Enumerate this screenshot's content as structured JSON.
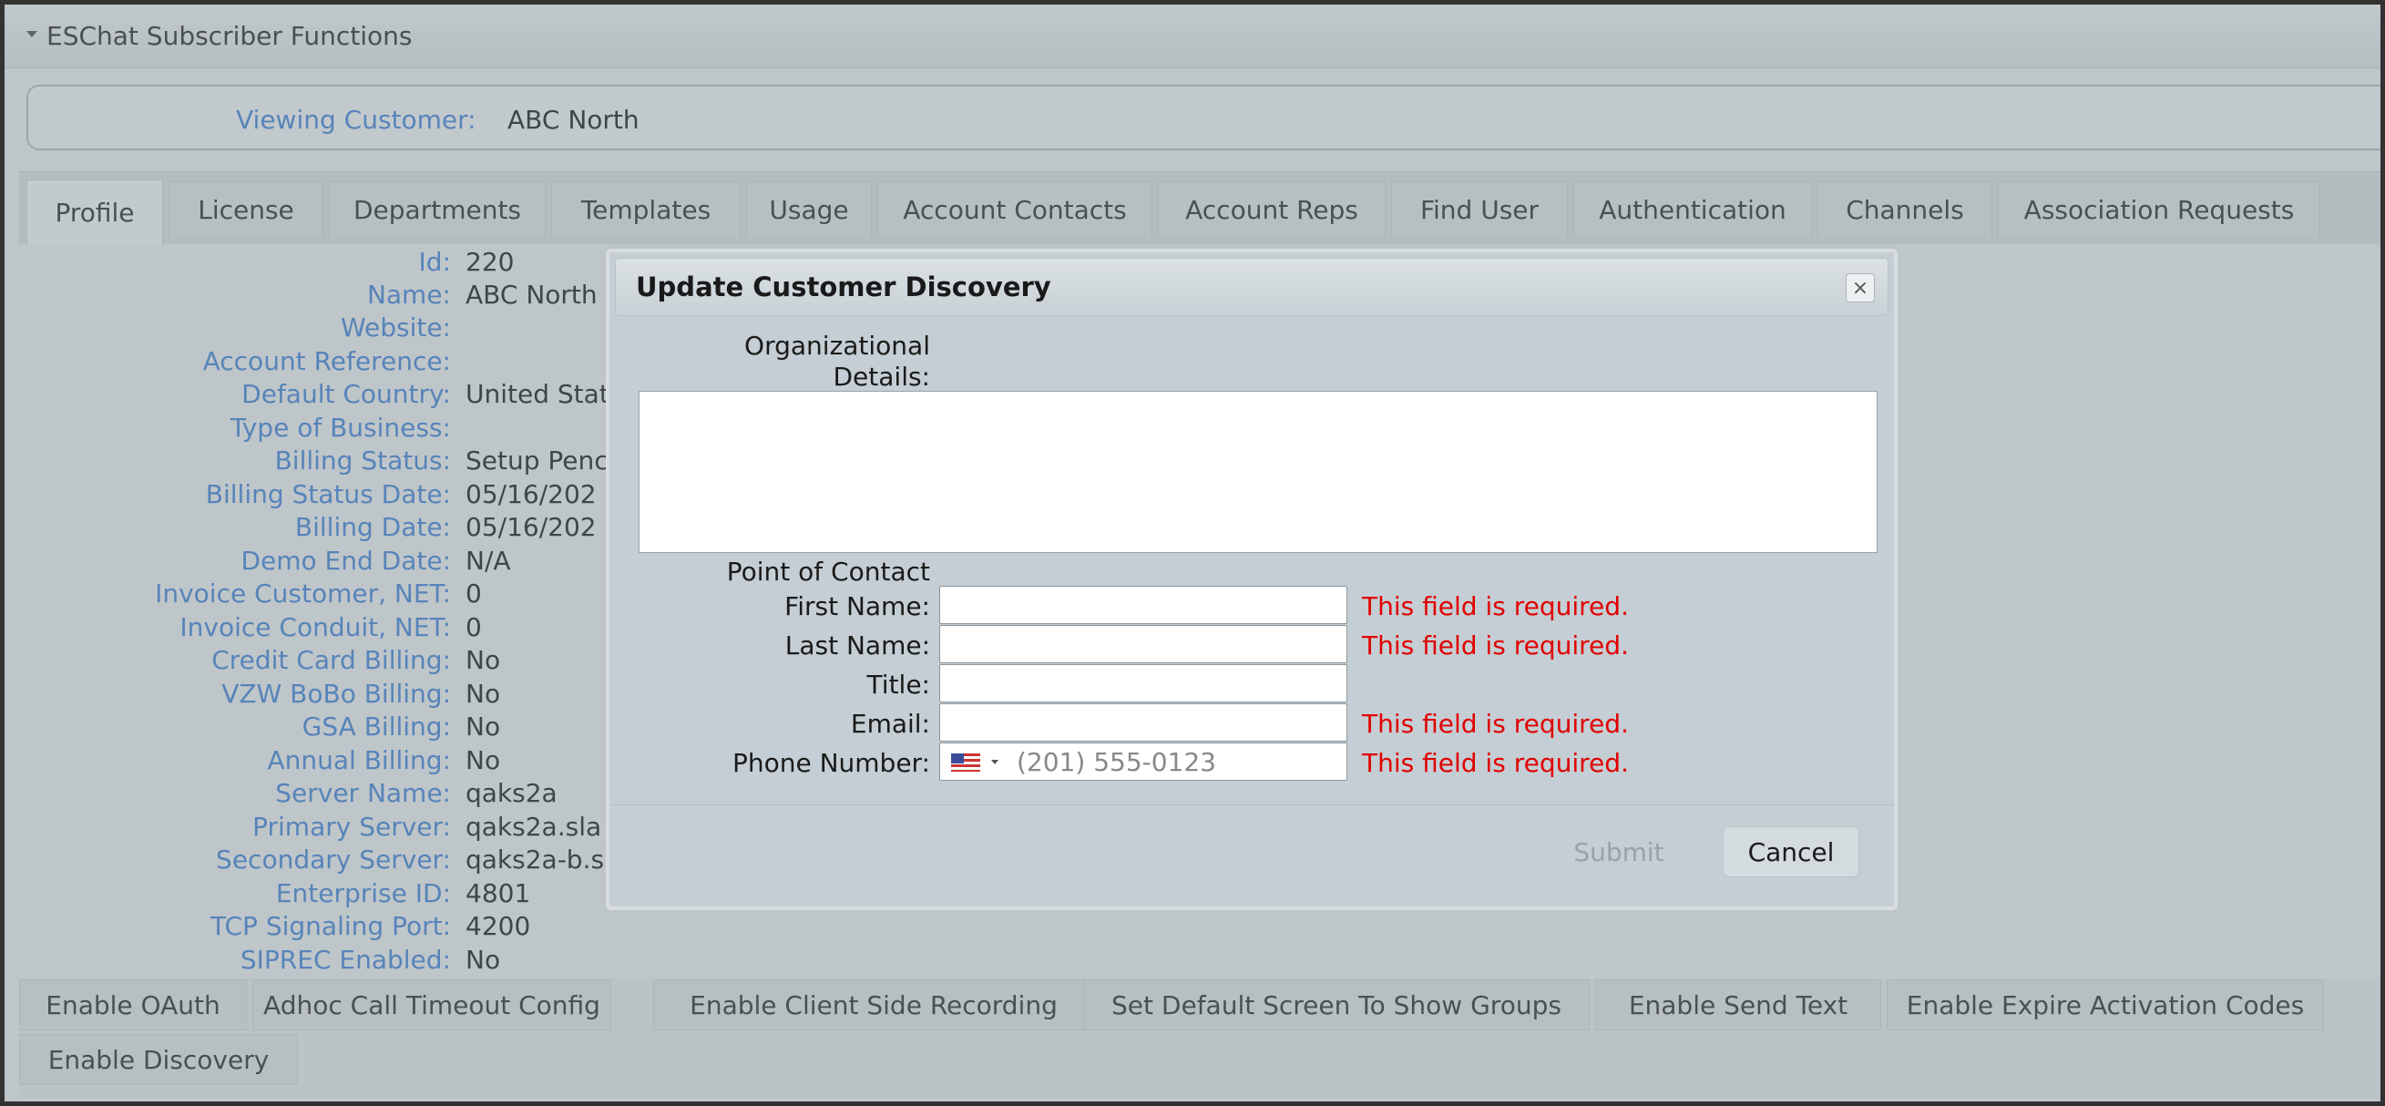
{
  "panel": {
    "title": "ESChat Subscriber Functions"
  },
  "customer": {
    "label": "Viewing Customer:",
    "value": "ABC North"
  },
  "tabs": [
    "Profile",
    "License",
    "Departments",
    "Templates",
    "Usage",
    "Account Contacts",
    "Account Reps",
    "Find User",
    "Authentication",
    "Channels",
    "Association Requests"
  ],
  "profile": [
    {
      "label": "Id:",
      "value": "220"
    },
    {
      "label": "Name:",
      "value": "ABC North"
    },
    {
      "label": "Website:",
      "value": ""
    },
    {
      "label": "Account Reference:",
      "value": ""
    },
    {
      "label": "Default Country:",
      "value": "United Stat"
    },
    {
      "label": "Type of Business:",
      "value": ""
    },
    {
      "label": "Billing Status:",
      "value": "Setup Penc"
    },
    {
      "label": "Billing Status Date:",
      "value": "05/16/202"
    },
    {
      "label": "Billing Date:",
      "value": "05/16/202"
    },
    {
      "label": "Demo End Date:",
      "value": "N/A"
    },
    {
      "label": "Invoice Customer, NET:",
      "value": "0"
    },
    {
      "label": "Invoice Conduit, NET:",
      "value": "0"
    },
    {
      "label": "Credit Card Billing:",
      "value": "No"
    },
    {
      "label": "VZW BoBo Billing:",
      "value": "No"
    },
    {
      "label": "GSA Billing:",
      "value": "No"
    },
    {
      "label": "Annual Billing:",
      "value": "No"
    },
    {
      "label": "Server Name:",
      "value": "qaks2a"
    },
    {
      "label": "Primary Server:",
      "value": "qaks2a.sla"
    },
    {
      "label": "Secondary Server:",
      "value": "qaks2a-b.s"
    },
    {
      "label": "Enterprise ID:",
      "value": "4801"
    },
    {
      "label": "TCP Signaling Port:",
      "value": "4200"
    },
    {
      "label": "SIPREC Enabled:",
      "value": "No"
    }
  ],
  "bottom_buttons": [
    "Enable OAuth",
    "Adhoc Call Timeout Config",
    "Enable Client Side Recording",
    "Set Default Screen To Show Groups",
    "Enable Send Text",
    "Enable Expire Activation Codes",
    "Enable Discovery"
  ],
  "dialog": {
    "title": "Update Customer Discovery",
    "close": "×",
    "org_label_line1": "Organizational",
    "org_label_line2": "Details:",
    "org_value": "",
    "poc_heading": "Point of Contact",
    "fields": [
      {
        "label": "First Name:",
        "value": "",
        "error": "This field is required."
      },
      {
        "label": "Last Name:",
        "value": "",
        "error": "This field is required."
      },
      {
        "label": "Title:",
        "value": "",
        "error": ""
      },
      {
        "label": "Email:",
        "value": "",
        "error": "This field is required."
      },
      {
        "label": "Phone Number:",
        "value": "",
        "placeholder": "(201) 555-0123",
        "error": "This field is required."
      }
    ],
    "submit": "Submit",
    "cancel": "Cancel"
  },
  "colors": {
    "label_blue": "#4a86d6",
    "error_red": "#e00000"
  },
  "icons": {
    "collapse": "caret-down-icon",
    "close": "close-icon",
    "flag": "us-flag-icon"
  }
}
